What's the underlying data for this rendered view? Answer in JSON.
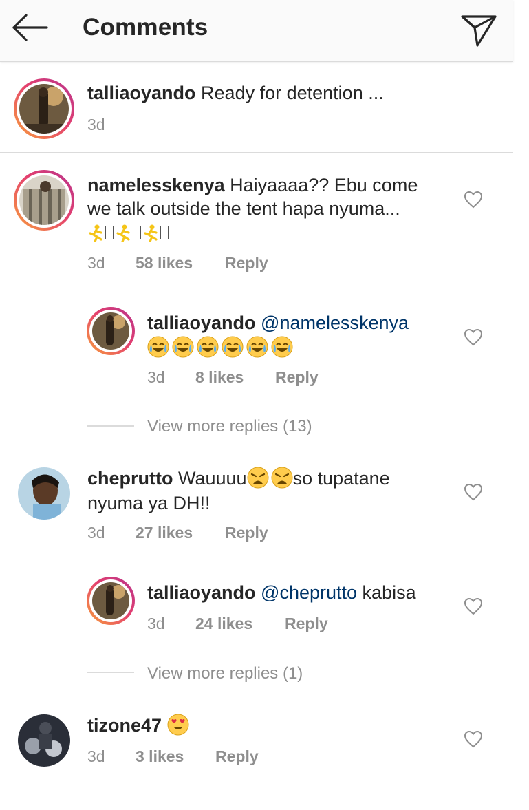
{
  "header": {
    "title": "Comments",
    "back_icon": "arrow-left-icon",
    "send_icon": "paper-plane-icon"
  },
  "caption": {
    "username": "talliaoyando",
    "text": "Ready for detention ...",
    "time": "3d"
  },
  "comments": [
    {
      "username": "namelesskenya",
      "text_line1": "Haiyaaaa?? Ebu come",
      "text_line2": "we talk outside the tent hapa nyuma...",
      "emoji_line": "runner-emoji x3 with missing glyph boxes",
      "time": "3d",
      "likes": "58 likes",
      "reply": "Reply",
      "replies": [
        {
          "username": "talliaoyando",
          "mention": "@namelesskenya",
          "emoji": "joy-emoji x6",
          "time": "3d",
          "likes": "8 likes",
          "reply": "Reply"
        }
      ],
      "view_more": "View more replies (13)"
    },
    {
      "username": "cheprutto",
      "text_before": "Wauuuu",
      "text_after": "so tupatane",
      "text_line2": "nyuma ya DH!!",
      "emoji": "weary-emoji x2",
      "time": "3d",
      "likes": "27 likes",
      "reply": "Reply",
      "replies": [
        {
          "username": "talliaoyando",
          "mention": "@cheprutto",
          "text": "kabisa",
          "time": "3d",
          "likes": "24 likes",
          "reply": "Reply"
        }
      ],
      "view_more": "View more replies (1)"
    },
    {
      "username": "tizone47",
      "emoji": "heart-eyes-emoji",
      "time": "3d",
      "likes": "3 likes",
      "reply": "Reply"
    }
  ],
  "colors": {
    "text": "#262626",
    "muted": "#8e8e8e",
    "mention": "#003569",
    "story_ring_start": "#f9a13a",
    "story_ring_end": "#b6338d"
  },
  "heart_icon": "heart-outline-icon"
}
